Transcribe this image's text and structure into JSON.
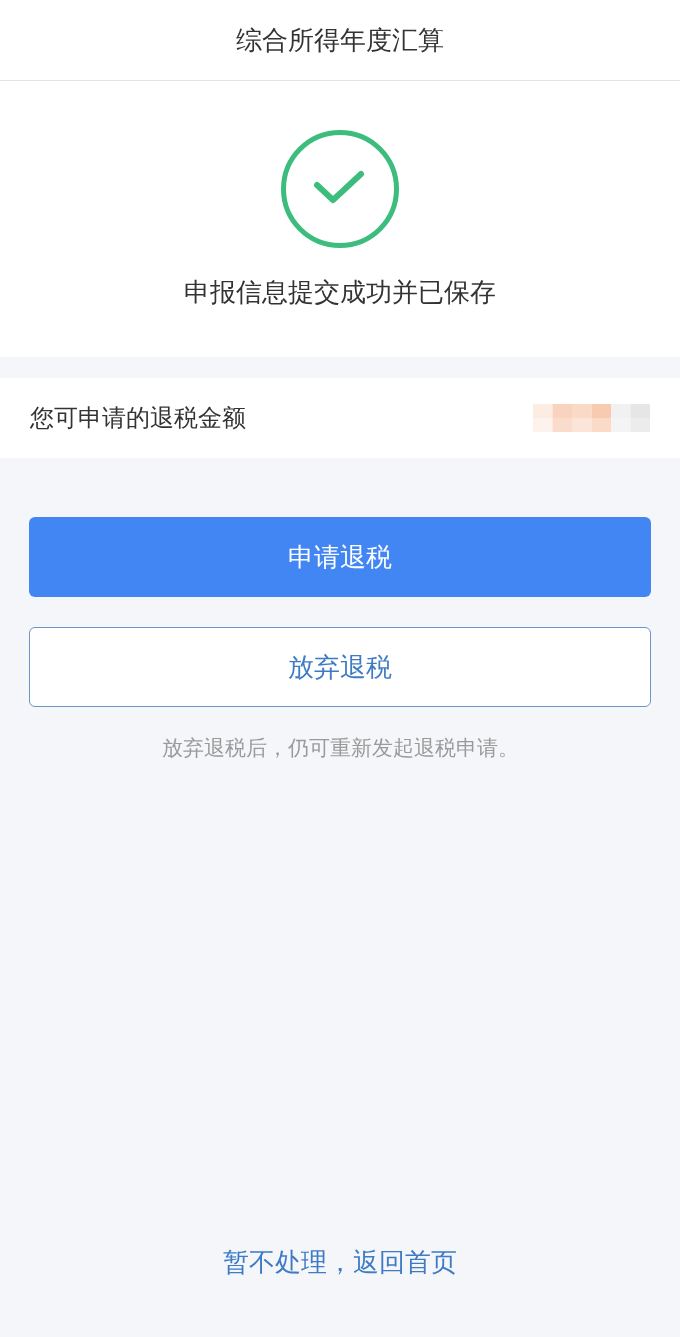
{
  "header": {
    "title": "综合所得年度汇算"
  },
  "result": {
    "kind": "success",
    "message": "申报信息提交成功并已保存"
  },
  "refund": {
    "label": "您可申请的退税金额",
    "amount_obscured": true
  },
  "actions": [
    {
      "kind": "primary",
      "label": "申请退税"
    },
    {
      "kind": "secondary",
      "label": "放弃退税"
    }
  ],
  "note": "放弃退税后，仍可重新发起退税申请。",
  "footer_link": "暂不处理，返回首页"
}
